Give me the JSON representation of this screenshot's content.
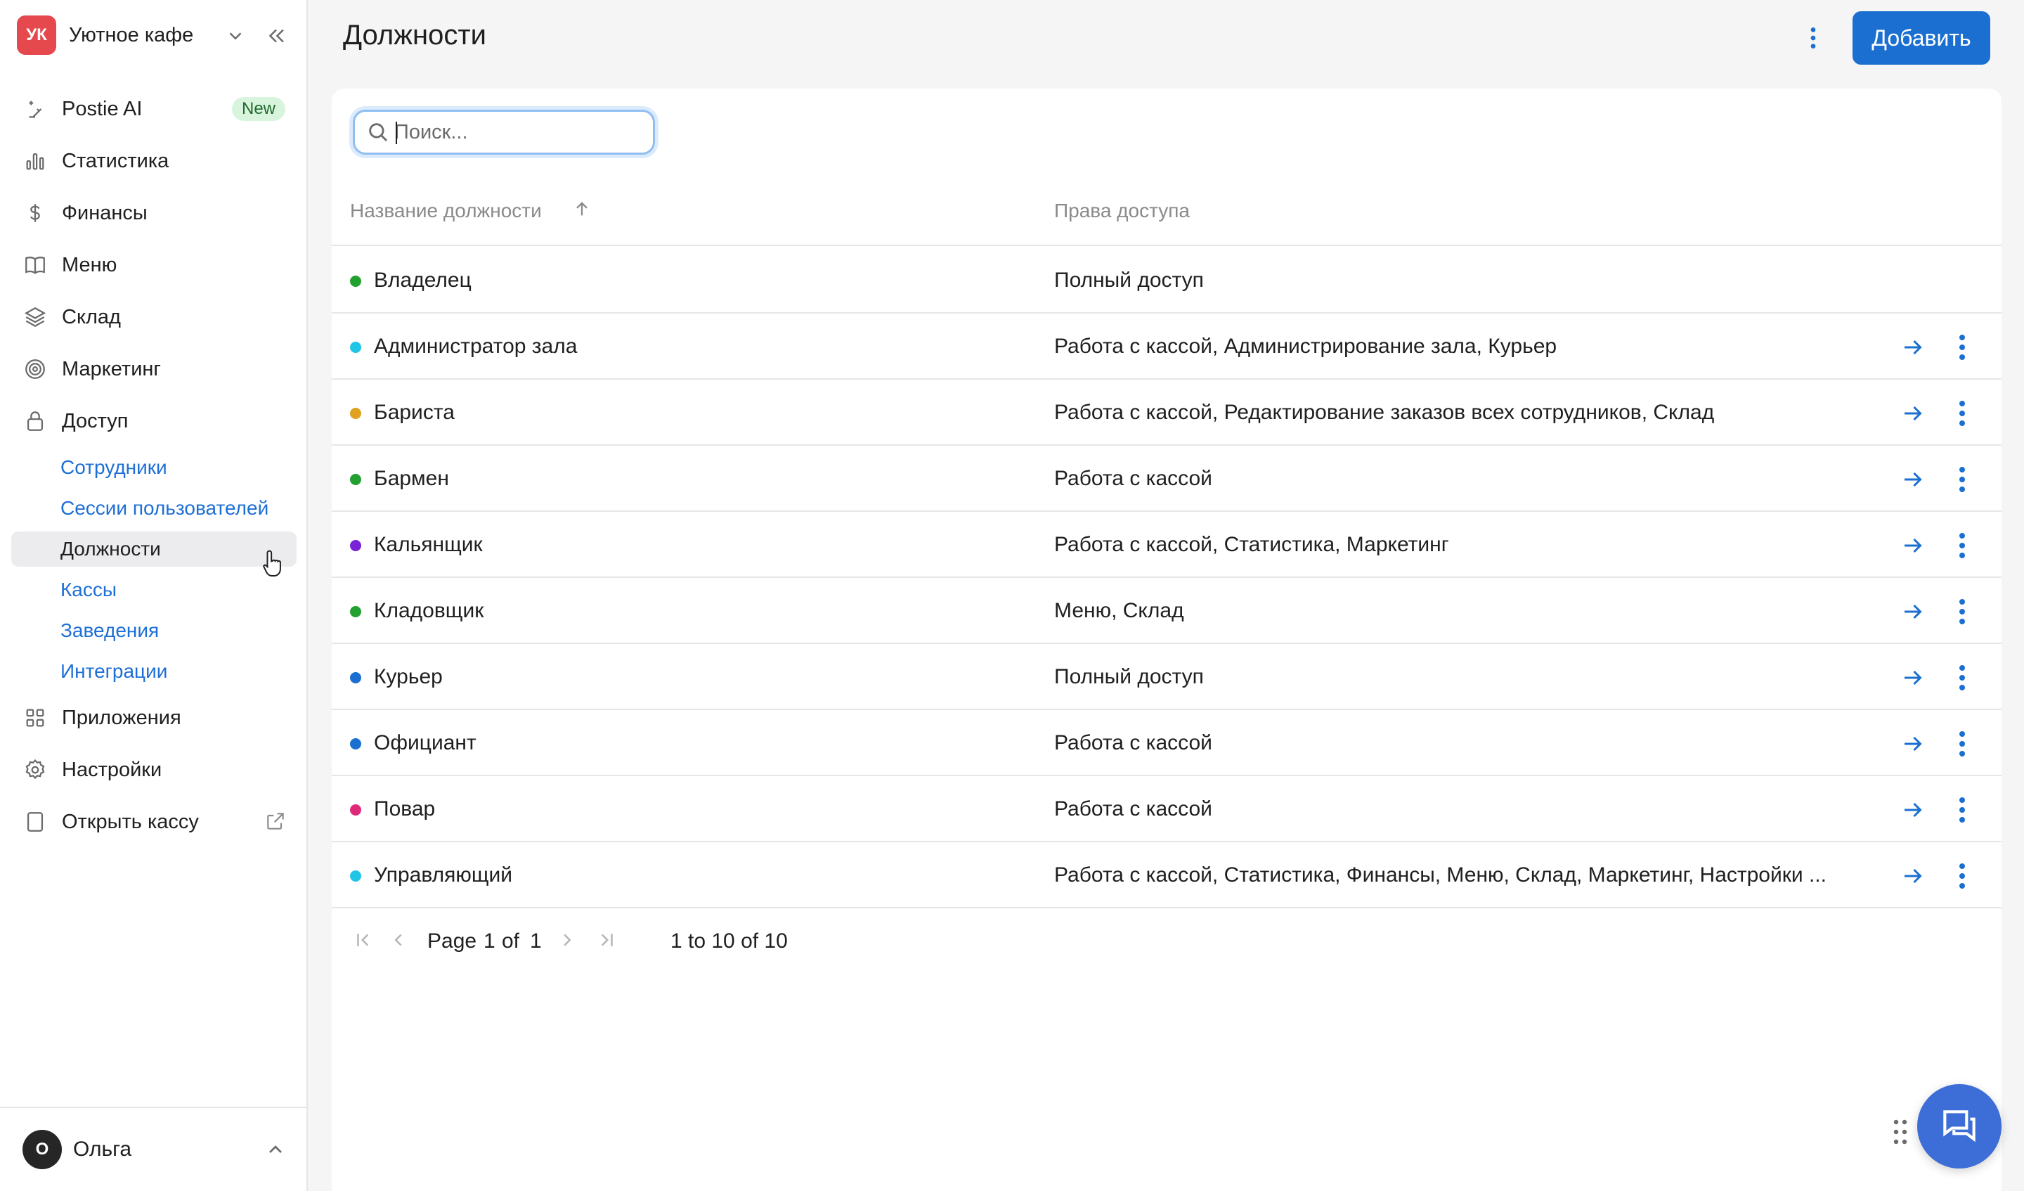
{
  "brand": {
    "initials": "УК",
    "name": "Уютное кафе"
  },
  "nav": [
    {
      "id": "postie-ai",
      "label": "Postie AI",
      "icon": "sparkle-pen-icon",
      "badge": "New"
    },
    {
      "id": "statistics",
      "label": "Статистика",
      "icon": "bar-chart-icon"
    },
    {
      "id": "finance",
      "label": "Финансы",
      "icon": "dollar-icon"
    },
    {
      "id": "menu",
      "label": "Меню",
      "icon": "book-icon"
    },
    {
      "id": "warehouse",
      "label": "Склад",
      "icon": "layers-icon"
    },
    {
      "id": "marketing",
      "label": "Маркетинг",
      "icon": "target-icon"
    },
    {
      "id": "access",
      "label": "Доступ",
      "icon": "lock-icon"
    }
  ],
  "subnav": [
    {
      "id": "employees",
      "label": "Сотрудники",
      "active": false
    },
    {
      "id": "sessions",
      "label": "Сессии пользователей",
      "active": false
    },
    {
      "id": "positions",
      "label": "Должности",
      "active": true
    },
    {
      "id": "cash-registers",
      "label": "Кассы",
      "active": false
    },
    {
      "id": "venues",
      "label": "Заведения",
      "active": false
    },
    {
      "id": "integrations",
      "label": "Интеграции",
      "active": false
    }
  ],
  "nav_bottom": [
    {
      "id": "apps",
      "label": "Приложения",
      "icon": "grid-icon"
    },
    {
      "id": "settings",
      "label": "Настройки",
      "icon": "gear-icon"
    },
    {
      "id": "open-register",
      "label": "Открыть кассу",
      "icon": "tablet-icon"
    }
  ],
  "user": {
    "initial": "О",
    "name": "Ольга"
  },
  "header": {
    "title": "Должности",
    "add_label": "Добавить"
  },
  "search": {
    "placeholder": "Поиск..."
  },
  "table": {
    "columns": [
      "Название должности",
      "Права доступа"
    ],
    "rows": [
      {
        "name": "Владелец",
        "perm": "Полный доступ",
        "color": "#22a030",
        "actions": false
      },
      {
        "name": "Администратор зала",
        "perm": "Работа с кассой, Администрирование зала, Курьер",
        "color": "#20c5e6",
        "actions": true
      },
      {
        "name": "Бариста",
        "perm": "Работа с кассой, Редактирование заказов всех сотрудников, Склад",
        "color": "#e0a020",
        "actions": true
      },
      {
        "name": "Бармен",
        "perm": "Работа с кассой",
        "color": "#22a030",
        "actions": true
      },
      {
        "name": "Кальянщик",
        "perm": "Работа с кассой, Статистика, Маркетинг",
        "color": "#7a22d8",
        "actions": true
      },
      {
        "name": "Кладовщик",
        "perm": "Меню, Склад",
        "color": "#22a030",
        "actions": true
      },
      {
        "name": "Курьер",
        "perm": "Полный доступ",
        "color": "#1a6fd1",
        "actions": true
      },
      {
        "name": "Официант",
        "perm": "Работа с кассой",
        "color": "#1a6fd1",
        "actions": true
      },
      {
        "name": "Повар",
        "perm": "Работа с кассой",
        "color": "#e0287a",
        "actions": true
      },
      {
        "name": "Управляющий",
        "perm": "Работа с кассой, Статистика, Финансы, Меню, Склад, Маркетинг, Настройки ...",
        "color": "#20c5e6",
        "actions": true
      }
    ]
  },
  "pager": {
    "page_prefix": "Page",
    "page": "1",
    "of": "of",
    "total_pages": "1",
    "range": "1 to 10 of 10"
  },
  "colors": {
    "accent": "#1a6fd1",
    "link": "#1d6fd6",
    "brand": "#e5484d",
    "fab": "#3d6dd6"
  }
}
